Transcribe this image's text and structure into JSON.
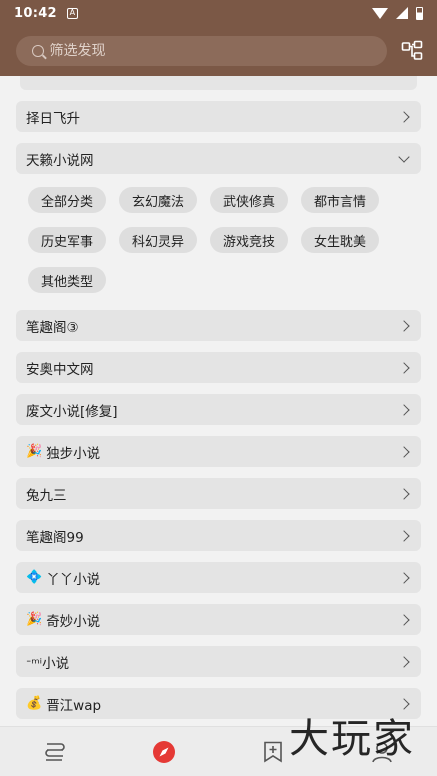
{
  "status": {
    "time": "10:42"
  },
  "search": {
    "placeholder": "筛选发现"
  },
  "rows": [
    {
      "label": "择日飞升",
      "emoji": "",
      "expanded": false
    },
    {
      "label": "天籁小说网",
      "emoji": "",
      "expanded": true
    }
  ],
  "chips": [
    "全部分类",
    "玄幻魔法",
    "武侠修真",
    "都市言情",
    "历史军事",
    "科幻灵异",
    "游戏竞技",
    "女生耽美",
    "其他类型"
  ],
  "rows_after": [
    {
      "label": "笔趣阁③",
      "emoji": ""
    },
    {
      "label": "安奥中文网",
      "emoji": ""
    },
    {
      "label": "废文小说[修复]",
      "emoji": ""
    },
    {
      "label": "独步小说",
      "emoji": "🎉"
    },
    {
      "label": "兔九三",
      "emoji": ""
    },
    {
      "label": "笔趣阁99",
      "emoji": ""
    },
    {
      "label": "丫丫小说",
      "emoji": "💠"
    },
    {
      "label": "奇妙小说",
      "emoji": "🎉"
    },
    {
      "label": "ᐨᵐⁱ小说",
      "emoji": ""
    },
    {
      "label": "晋江wap",
      "emoji": "💰"
    }
  ],
  "watermark": "大玩家",
  "colors": {
    "primary": "#7b5846",
    "accent": "#e53935"
  }
}
